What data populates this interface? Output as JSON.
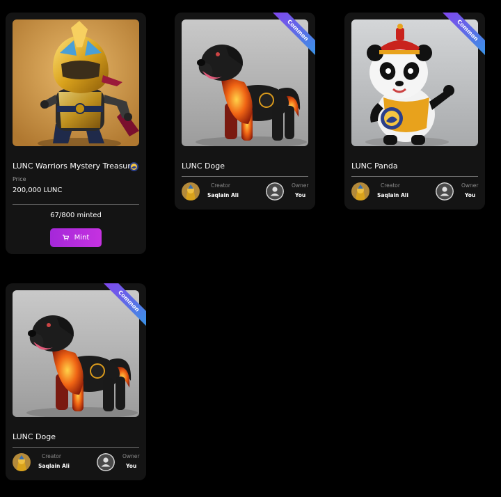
{
  "cards": [
    {
      "title": "LUNC Warriors Mystery Treasure",
      "price_label": "Price",
      "price": "200,000 LUNC",
      "minted": "67/800 minted",
      "mint_label": "Mint",
      "image_icon": "golden-warrior-image"
    },
    {
      "title": "LUNC Doge",
      "ribbon": "Common",
      "creator_label": "Creator",
      "creator_name": "Saqlain Ali",
      "owner_label": "Owner",
      "owner_name": "You",
      "image_icon": "fire-dog-image"
    },
    {
      "title": "LUNC Panda",
      "ribbon": "Common",
      "creator_label": "Creator",
      "creator_name": "Saqlain Ali",
      "owner_label": "Owner",
      "owner_name": "You",
      "image_icon": "panda-image"
    },
    {
      "title": "LUNC Doge",
      "ribbon": "Common",
      "creator_label": "Creator",
      "creator_name": "Saqlain Ali",
      "owner_label": "Owner",
      "owner_name": "You",
      "image_icon": "fire-dog-image"
    }
  ],
  "colors": {
    "background": "#000000",
    "card": "#141414",
    "mint_button": "#b42ddc",
    "ribbon_start": "#8a3df0",
    "ribbon_end": "#2fa0e8"
  }
}
